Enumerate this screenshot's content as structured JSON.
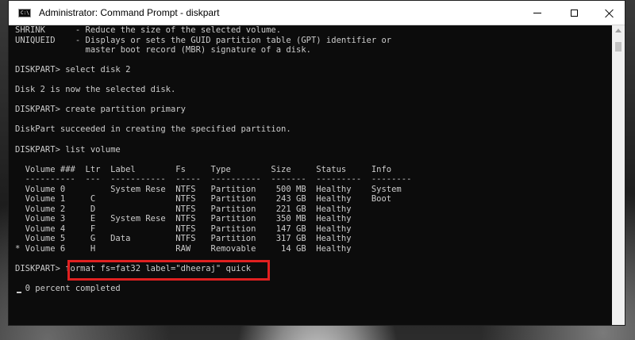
{
  "window": {
    "title": "Administrator: Command Prompt - diskpart",
    "icon_label": "C:\\",
    "controls": [
      "minimize-icon",
      "maximize-icon",
      "close-icon"
    ]
  },
  "console": {
    "lines": [
      "SHRINK      - Reduce the size of the selected volume.",
      "UNIQUEID    - Displays or sets the GUID partition table (GPT) identifier or",
      "              master boot record (MBR) signature of a disk.",
      "",
      "DISKPART> select disk 2",
      "",
      "Disk 2 is now the selected disk.",
      "",
      "DISKPART> create partition primary",
      "",
      "DiskPart succeeded in creating the specified partition.",
      "",
      "DISKPART> list volume",
      "",
      "  Volume ###  Ltr  Label        Fs     Type        Size     Status     Info",
      "  ----------  ---  -----------  -----  ----------  -------  ---------  --------",
      "  Volume 0         System Rese  NTFS   Partition    500 MB  Healthy    System",
      "  Volume 1     C                NTFS   Partition    243 GB  Healthy    Boot",
      "  Volume 2     D                NTFS   Partition    221 GB  Healthy",
      "  Volume 3     E   System Rese  NTFS   Partition    350 MB  Healthy",
      "  Volume 4     F                NTFS   Partition    147 GB  Healthy",
      "  Volume 5     G   Data         NTFS   Partition    317 GB  Healthy",
      "* Volume 6     H                RAW    Removable     14 GB  Healthy",
      "",
      "DISKPART> format fs=fat32 label=\"dheeraj\" quick",
      "",
      "  0 percent completed"
    ]
  },
  "annotation": {
    "color": "#e02020"
  }
}
